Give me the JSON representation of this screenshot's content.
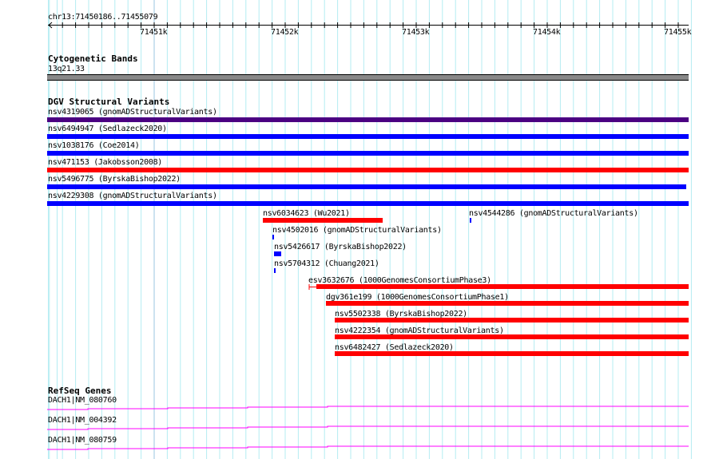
{
  "ruler": {
    "location": "chr13:71450186..71455079",
    "ticks": [
      "71451k",
      "71452k",
      "71453k",
      "71454k",
      "71455k"
    ]
  },
  "cytobands": {
    "title": "Cytogenetic Bands",
    "band": "13q21.33",
    "color": "#888888"
  },
  "dgv": {
    "title": "DGV Structural Variants",
    "features": [
      {
        "label": "nsv4319065 (gnomADStructuralVariants)",
        "color": "#4b0082"
      },
      {
        "label": "nsv6494947 (Sedlazeck2020)",
        "color": "#0000ff"
      },
      {
        "label": "nsv1038176 (Coe2014)",
        "color": "#0000ff"
      },
      {
        "label": "nsv471153 (Jakobsson2008)",
        "color": "#ff0000"
      },
      {
        "label": "nsv5496775 (ByrskaBishop2022)",
        "color": "#0000ff"
      },
      {
        "label": "nsv4229308 (gnomADStructuralVariants)",
        "color": "#0000ff"
      },
      {
        "label": "nsv6034623 (Wu2021)",
        "color": "#ff0000"
      },
      {
        "label": "nsv4544286 (gnomADStructuralVariants)",
        "color": "#0000ff"
      },
      {
        "label": "nsv4502016 (gnomADStructuralVariants)",
        "color": "#0000ff"
      },
      {
        "label": "nsv5426617 (ByrskaBishop2022)",
        "color": "#0000ff"
      },
      {
        "label": "nsv5704312 (Chuang2021)",
        "color": "#0000ff"
      },
      {
        "label": "esv3632676 (1000GenomesConsortiumPhase3)",
        "color": "#ff0000"
      },
      {
        "label": "dgv361e199 (1000GenomesConsortiumPhase1)",
        "color": "#ff0000"
      },
      {
        "label": "nsv5502338 (ByrskaBishop2022)",
        "color": "#ff0000"
      },
      {
        "label": "nsv4222354 (gnomADStructuralVariants)",
        "color": "#ff0000"
      },
      {
        "label": "nsv6482427 (Sedlazeck2020)",
        "color": "#ff0000"
      }
    ]
  },
  "refseq": {
    "title": "RefSeq Genes",
    "color": "#ff00ff",
    "genes": [
      {
        "label": "DACH1|NM_080760"
      },
      {
        "label": "DACH1|NM_004392"
      },
      {
        "label": "DACH1|NM_080759"
      }
    ]
  }
}
